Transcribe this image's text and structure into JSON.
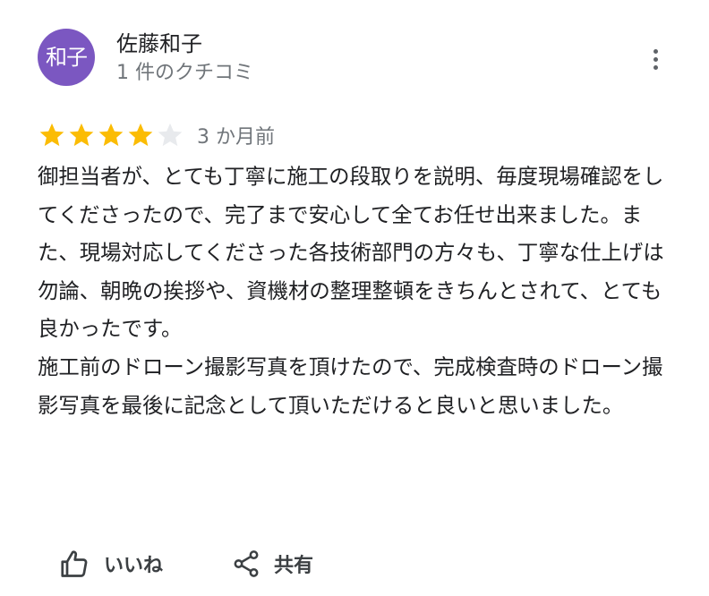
{
  "reviewer": {
    "avatar_text": "和子",
    "avatar_color": "#7b57c1",
    "name": "佐藤和子",
    "meta": "1 件のクチコミ"
  },
  "menu": {
    "icon": "more-vert-icon"
  },
  "rating": {
    "value": 4,
    "max": 5,
    "filled_color": "#fbbc04",
    "empty_color": "#e8eaed",
    "time_ago": "3 か月前"
  },
  "review": {
    "paragraphs": [
      "御担当者が、とても丁寧に施工の段取りを説明、毎度現場確認をしてくださったので、完了まで安心して全てお任せ出来ました。また、現場対応してくださった各技術部門の方々も、丁寧な仕上げは勿論、朝晩の挨拶や、資機材の整理整頓をきちんとされて、とても良かったです。",
      "施工前のドローン撮影写真を頂けたので、完成検査時のドローン撮影写真を最後に記念として頂いただけると良いと思いました。"
    ]
  },
  "actions": {
    "like_icon": "thumb-up-icon",
    "like_label": "いいね",
    "share_icon": "share-icon",
    "share_label": "共有"
  }
}
